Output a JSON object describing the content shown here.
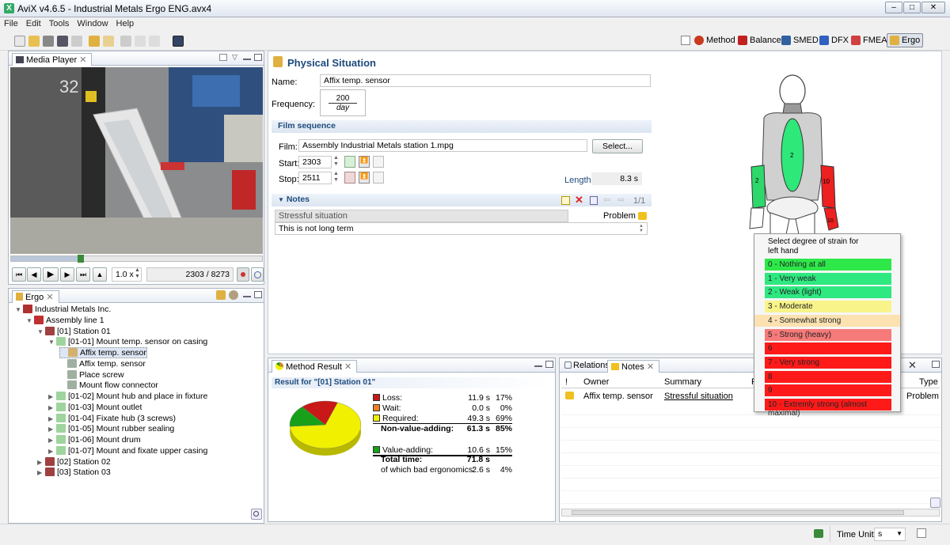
{
  "window": {
    "title": "AviX v4.6.5 - Industrial Metals Ergo ENG.avx4"
  },
  "menu": [
    "File",
    "Edit",
    "Tools",
    "Window",
    "Help"
  ],
  "perspectives": [
    {
      "label": "Method",
      "color": "#c83a1e"
    },
    {
      "label": "Balance",
      "color": "#c02020"
    },
    {
      "label": "SMED",
      "color": "#3060a0"
    },
    {
      "label": "DFX",
      "color": "#3060c0"
    },
    {
      "label": "FMEA",
      "color": "#d04040"
    },
    {
      "label": "Ergo",
      "color": "#e0b040"
    }
  ],
  "media_player": {
    "tab": "Media Player",
    "speed": "1.0 x",
    "frame": "2303 / 8273",
    "progress": 0.278
  },
  "ergo_tree": {
    "tab": "Ergo",
    "items": [
      {
        "label": "Industrial Metals Inc.",
        "indent": 0,
        "exp": "▼",
        "icon": "#b03030"
      },
      {
        "label": "Assembly line 1",
        "indent": 1,
        "exp": "▼",
        "icon": "#c03030"
      },
      {
        "label": "[01] Station 01",
        "indent": 2,
        "exp": "▼",
        "icon": "#a04040"
      },
      {
        "label": "[01-01] Mount temp. sensor on casing",
        "indent": 3,
        "exp": "▼",
        "icon": "#9ed49e"
      },
      {
        "label": "Affix temp. sensor",
        "indent": 4,
        "exp": "",
        "icon": "#d4b070",
        "selected": true
      },
      {
        "label": "Affix temp. sensor",
        "indent": 4,
        "exp": "",
        "icon": "#a0b0a0"
      },
      {
        "label": "Place screw",
        "indent": 4,
        "exp": "",
        "icon": "#a0b0a0"
      },
      {
        "label": "Mount flow connector",
        "indent": 4,
        "exp": "",
        "icon": "#a0b0a0"
      },
      {
        "label": "[01-02] Mount hub and place in fixture",
        "indent": 3,
        "exp": "▶",
        "icon": "#9ed49e"
      },
      {
        "label": "[01-03] Mount outlet",
        "indent": 3,
        "exp": "▶",
        "icon": "#9ed49e"
      },
      {
        "label": "[01-04] Fixate hub (3 screws)",
        "indent": 3,
        "exp": "▶",
        "icon": "#9ed49e"
      },
      {
        "label": "[01-05] Mount rubber sealing",
        "indent": 3,
        "exp": "▶",
        "icon": "#9ed49e"
      },
      {
        "label": "[01-06] Mount drum",
        "indent": 3,
        "exp": "▶",
        "icon": "#9ed49e"
      },
      {
        "label": "[01-07] Mount and fixate upper casing",
        "indent": 3,
        "exp": "▶",
        "icon": "#9ed49e"
      },
      {
        "label": "[02] Station 02",
        "indent": 2,
        "exp": "▶",
        "icon": "#a04040"
      },
      {
        "label": "[03] Station 03",
        "indent": 2,
        "exp": "▶",
        "icon": "#a04040"
      }
    ]
  },
  "physical": {
    "title": "Physical Situation",
    "name_label": "Name:",
    "name_value": "Affix temp. sensor",
    "freq_label": "Frequency:",
    "freq_num": "200",
    "freq_den": "day"
  },
  "film": {
    "section": "Film sequence",
    "film_label": "Film:",
    "film_value": "Assembly Industrial Metals station 1.mpg",
    "select_btn": "Select...",
    "start_label": "Start:",
    "start_value": "2303",
    "stop_label": "Stop:",
    "stop_value": "2511",
    "length_label": "Length:",
    "length_value": "8.3 s"
  },
  "notes": {
    "section": "Notes",
    "count": "1/1",
    "col1": "Stressful situation",
    "col2": "Problem",
    "text": "This is not long term"
  },
  "body": {
    "trunk_value": "2",
    "left_arm_value": "2",
    "right_arm_value": "10",
    "right_hand_value": "10",
    "colors": {
      "trunk": "#2ee87a",
      "left_arm": "#2ed86a",
      "right_arm": "#ee2020",
      "hand": "#ee2020"
    }
  },
  "strain_popup": {
    "title": "Select degree of strain for\nleft hand",
    "options": [
      {
        "label": "0 - Nothing at all",
        "color": "#2ee84a"
      },
      {
        "label": "1 - Very weak",
        "color": "#2ee880"
      },
      {
        "label": "2 - Weak (light)",
        "color": "#2ee880"
      },
      {
        "label": "3 - Moderate",
        "color": "#f8f48a"
      },
      {
        "label": "4 - Somewhat strong",
        "color": "#fbe2b0"
      },
      {
        "label": "5 - Strong (heavy)",
        "color": "#f67a7a"
      },
      {
        "label": "6",
        "color": "#ff1a1a"
      },
      {
        "label": "7 - Very strong",
        "color": "#ff1a1a"
      },
      {
        "label": "8",
        "color": "#ff1a1a"
      },
      {
        "label": "9",
        "color": "#ff1a1a"
      },
      {
        "label": "10 - Extremly strong (almost maximal)",
        "color": "#ff1a1a"
      }
    ]
  },
  "method_result": {
    "tab": "Method Result",
    "header": "Result for \"[01] Station 01\"",
    "rows": [
      {
        "label": "Loss:",
        "val": "11.9 s",
        "pct": "17%",
        "color": "#c81818",
        "bold": false
      },
      {
        "label": "Wait:",
        "val": "0.0 s",
        "pct": "0%",
        "color": "#f08020",
        "bold": false
      },
      {
        "label": "Required:",
        "val": "49.3 s",
        "pct": "69%",
        "color": "#f0f000",
        "bold": false
      },
      {
        "label": "Non-value-adding:",
        "val": "61.3 s",
        "pct": "85%",
        "color": "",
        "bold": true
      },
      {
        "label": "Value-adding:",
        "val": "10.6 s",
        "pct": "15%",
        "color": "#18a018",
        "bold": false
      },
      {
        "label": "Total time:",
        "val": "71.8 s",
        "pct": "",
        "color": "",
        "bold": true
      },
      {
        "label": "of which bad ergonomics:",
        "val": "2.6 s",
        "pct": "4%",
        "color": "",
        "bold": false
      }
    ],
    "pie": [
      {
        "value": 69,
        "color": "#f0f000"
      },
      {
        "value": 15,
        "color": "#18a018"
      },
      {
        "value": 17,
        "color": "#c81818"
      }
    ]
  },
  "relations": {
    "tab1": "Relations",
    "tab2": "Notes",
    "cols": [
      "!",
      "Owner",
      "Summary",
      "R",
      "Type"
    ],
    "row": {
      "owner": "Affix temp. sensor",
      "summary": "Stressful situation",
      "type": "Problem"
    }
  },
  "status": {
    "time_unit_label": "Time Unit:",
    "time_unit": "s"
  }
}
